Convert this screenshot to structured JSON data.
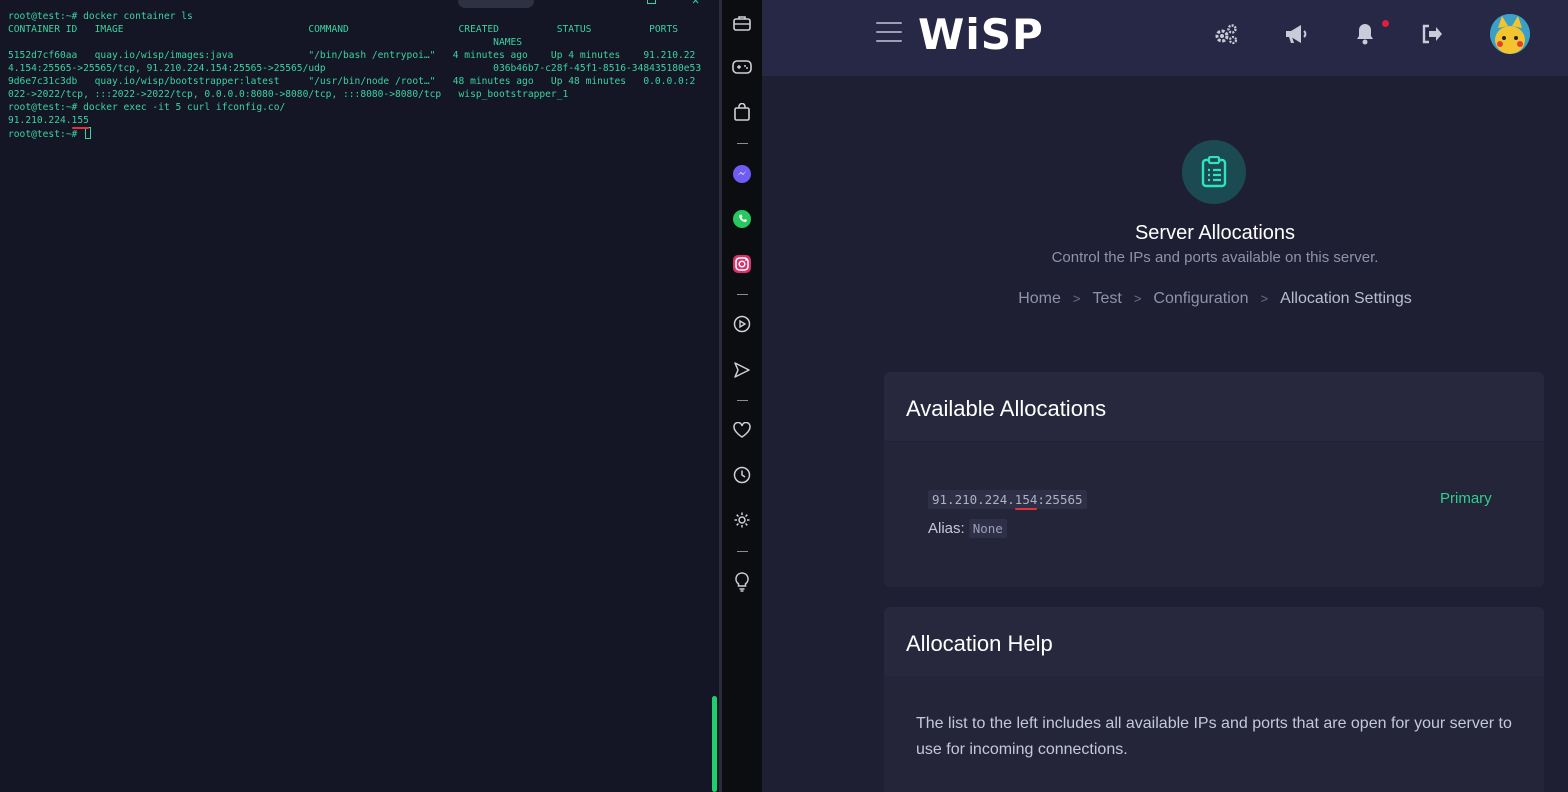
{
  "terminal": {
    "lines": [
      "root@test:~# docker container ls",
      "CONTAINER ID   IMAGE                                COMMAND                   CREATED          STATUS          PORTS",
      "                                                                                    NAMES",
      "5152d7cf60aa   quay.io/wisp/images:java             \"/bin/bash /entrypoi…\"   4 minutes ago    Up 4 minutes    91.210.22",
      "4.154:25565->25565/tcp, 91.210.224.154:25565->25565/udp                             036b46b7-c28f-45f1-8516-348435180e53",
      "9d6e7c31c3db   quay.io/wisp/bootstrapper:latest     \"/usr/bin/node /root…\"   48 minutes ago   Up 48 minutes   0.0.0.0:2",
      "022->2022/tcp, :::2022->2022/tcp, 0.0.0.0:8080->8080/tcp, :::8080->8080/tcp   wisp_bootstrapper_1",
      "root@test:~# docker exec -it 5 curl ifconfig.co/"
    ],
    "ip_output_prefix": "91.210.224.",
    "ip_output_suffix": "155",
    "prompt": "root@test:~# "
  },
  "browser_sidebar": {
    "icons": [
      "briefcase-icon",
      "gamepad-icon",
      "shopping-bag-icon",
      "messenger-icon",
      "whatsapp-icon",
      "instagram-icon",
      "play-icon",
      "send-icon",
      "heart-icon",
      "clock-icon",
      "settings-icon",
      "bulb-icon"
    ]
  },
  "app": {
    "logo": "WiSP",
    "page": {
      "title": "Server Allocations",
      "subtitle": "Control the IPs and ports available on this server."
    },
    "breadcrumb": [
      "Home",
      "Test",
      "Configuration",
      "Allocation Settings"
    ],
    "allocations_card": {
      "title": "Available Allocations",
      "ip_prefix": "91.210.224.",
      "ip_highlight": "154",
      "port": ":25565",
      "alias_label": "Alias:",
      "alias_value": "None",
      "badge": "Primary"
    },
    "help_card": {
      "title": "Allocation Help",
      "text": "The list to the left includes all available IPs and ports that are open for your server to use for incoming connections."
    }
  },
  "colors": {
    "terminal_text": "#3ad29f",
    "terminal_bg": "#141626",
    "app_bg": "#1f1f33",
    "accent_green": "#2ecf8f",
    "annotation_red": "#e0343a"
  }
}
